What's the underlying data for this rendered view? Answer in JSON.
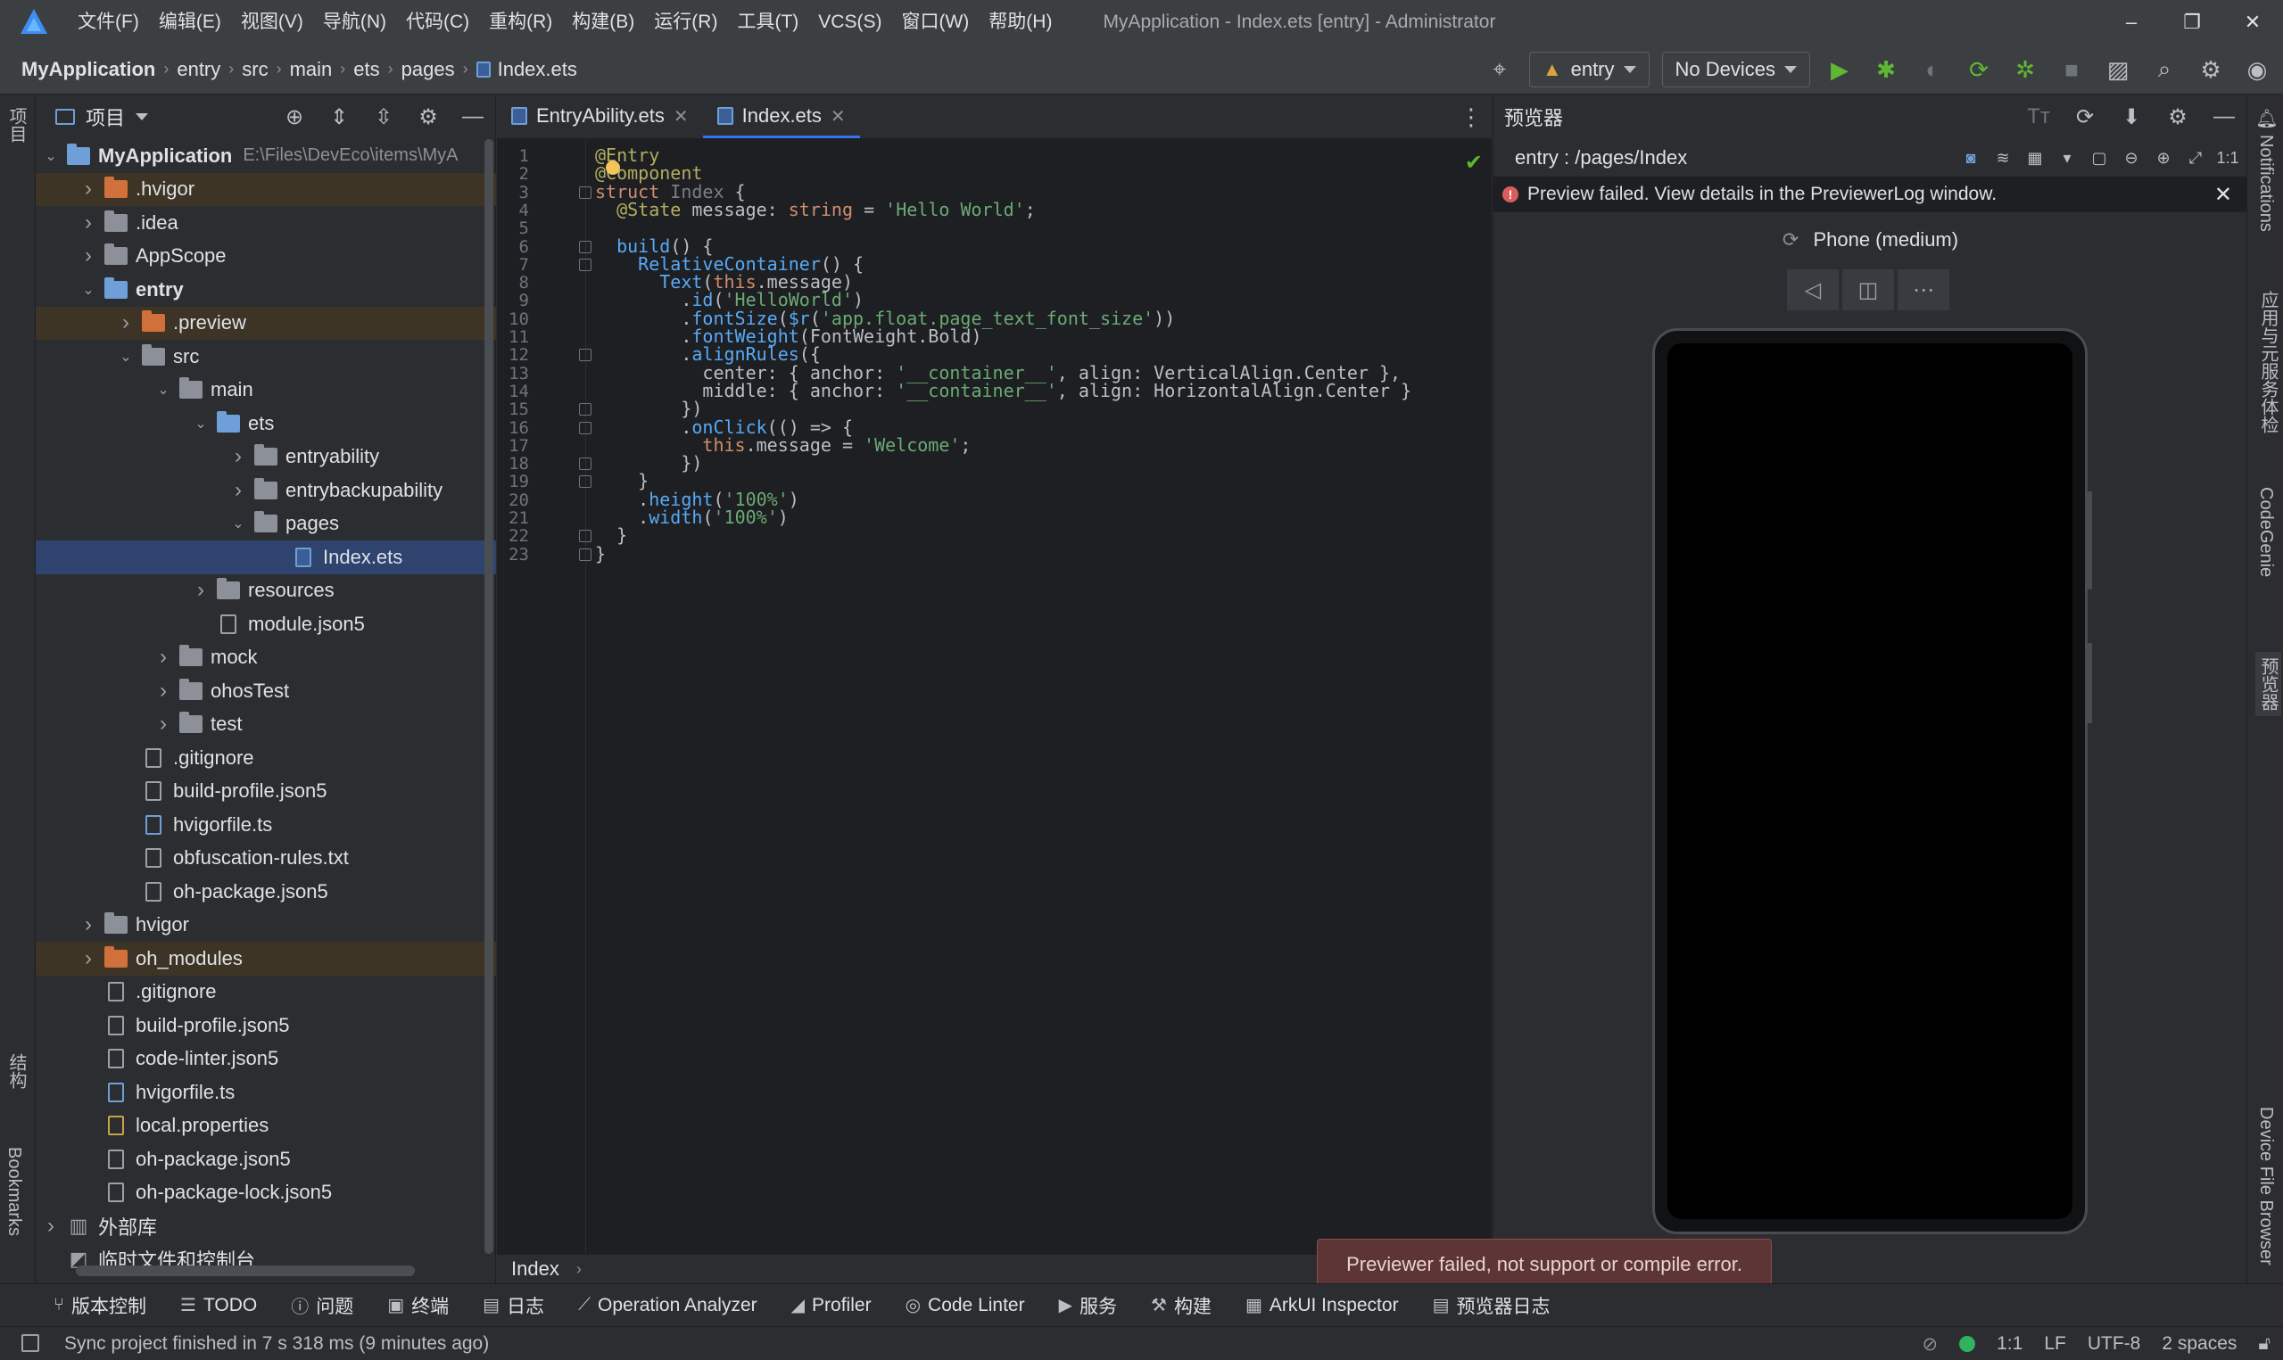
{
  "window": {
    "title": "MyApplication - Index.ets [entry] - Administrator",
    "menu": [
      "文件(F)",
      "编辑(E)",
      "视图(V)",
      "导航(N)",
      "代码(C)",
      "重构(R)",
      "构建(B)",
      "运行(R)",
      "工具(T)",
      "VCS(S)",
      "窗口(W)",
      "帮助(H)"
    ],
    "controls": [
      "–",
      "❐",
      "✕"
    ]
  },
  "breadcrumb": [
    "MyApplication",
    "entry",
    "src",
    "main",
    "ets",
    "pages",
    "Index.ets"
  ],
  "toolbar": {
    "module_combo": "entry",
    "device_combo": "No Devices"
  },
  "left_strip": {
    "top_tab": "项目",
    "structure_tab": "结构",
    "bookmarks_tab": "Bookmarks"
  },
  "project_panel": {
    "title": "项目",
    "tree": [
      {
        "depth": 0,
        "expanded": true,
        "has_chevron": true,
        "icon": "folder-blue",
        "label": "MyApplication",
        "hint": "E:\\Files\\DevEco\\items\\MyA",
        "bold": true
      },
      {
        "depth": 1,
        "expanded": false,
        "has_chevron": true,
        "icon": "folder-orange",
        "label": ".hvigor",
        "excluded": true
      },
      {
        "depth": 1,
        "expanded": false,
        "has_chevron": true,
        "icon": "folder",
        "label": ".idea"
      },
      {
        "depth": 1,
        "expanded": false,
        "has_chevron": true,
        "icon": "folder",
        "label": "AppScope"
      },
      {
        "depth": 1,
        "expanded": true,
        "has_chevron": true,
        "icon": "folder-blue",
        "label": "entry",
        "bold": true
      },
      {
        "depth": 2,
        "expanded": false,
        "has_chevron": true,
        "icon": "folder-orange",
        "label": ".preview",
        "excluded": true
      },
      {
        "depth": 2,
        "expanded": true,
        "has_chevron": true,
        "icon": "folder",
        "label": "src"
      },
      {
        "depth": 3,
        "expanded": true,
        "has_chevron": true,
        "icon": "folder",
        "label": "main"
      },
      {
        "depth": 4,
        "expanded": true,
        "has_chevron": true,
        "icon": "folder-blue",
        "label": "ets"
      },
      {
        "depth": 5,
        "expanded": false,
        "has_chevron": true,
        "icon": "folder",
        "label": "entryability"
      },
      {
        "depth": 5,
        "expanded": false,
        "has_chevron": true,
        "icon": "folder",
        "label": "entrybackupability"
      },
      {
        "depth": 5,
        "expanded": true,
        "has_chevron": true,
        "icon": "folder",
        "label": "pages"
      },
      {
        "depth": 6,
        "has_chevron": false,
        "icon": "file-ets",
        "label": "Index.ets",
        "selected": true
      },
      {
        "depth": 4,
        "expanded": false,
        "has_chevron": true,
        "icon": "folder",
        "label": "resources"
      },
      {
        "depth": 4,
        "has_chevron": false,
        "icon": "file",
        "label": "module.json5"
      },
      {
        "depth": 3,
        "expanded": false,
        "has_chevron": true,
        "icon": "folder",
        "label": "mock"
      },
      {
        "depth": 3,
        "expanded": false,
        "has_chevron": true,
        "icon": "folder",
        "label": "ohosTest"
      },
      {
        "depth": 3,
        "expanded": false,
        "has_chevron": true,
        "icon": "folder",
        "label": "test"
      },
      {
        "depth": 2,
        "has_chevron": false,
        "icon": "file",
        "label": ".gitignore"
      },
      {
        "depth": 2,
        "has_chevron": false,
        "icon": "file",
        "label": "build-profile.json5"
      },
      {
        "depth": 2,
        "has_chevron": false,
        "icon": "file-ts",
        "label": "hvigorfile.ts"
      },
      {
        "depth": 2,
        "has_chevron": false,
        "icon": "file",
        "label": "obfuscation-rules.txt"
      },
      {
        "depth": 2,
        "has_chevron": false,
        "icon": "file",
        "label": "oh-package.json5"
      },
      {
        "depth": 1,
        "expanded": false,
        "has_chevron": true,
        "icon": "folder",
        "label": "hvigor"
      },
      {
        "depth": 1,
        "expanded": false,
        "has_chevron": true,
        "icon": "folder-orange",
        "label": "oh_modules",
        "excluded": true
      },
      {
        "depth": 1,
        "has_chevron": false,
        "icon": "file",
        "label": ".gitignore"
      },
      {
        "depth": 1,
        "has_chevron": false,
        "icon": "file",
        "label": "build-profile.json5"
      },
      {
        "depth": 1,
        "has_chevron": false,
        "icon": "file",
        "label": "code-linter.json5"
      },
      {
        "depth": 1,
        "has_chevron": false,
        "icon": "file-ts",
        "label": "hvigorfile.ts"
      },
      {
        "depth": 1,
        "has_chevron": false,
        "icon": "file-prop",
        "label": "local.properties"
      },
      {
        "depth": 1,
        "has_chevron": false,
        "icon": "file",
        "label": "oh-package.json5"
      },
      {
        "depth": 1,
        "has_chevron": false,
        "icon": "file",
        "label": "oh-package-lock.json5"
      },
      {
        "depth": 0,
        "expanded": false,
        "has_chevron": true,
        "icon": "library",
        "label": "外部库"
      },
      {
        "depth": 0,
        "has_chevron": false,
        "icon": "scratch",
        "label": "临时文件和控制台"
      }
    ]
  },
  "editor": {
    "tabs": [
      {
        "label": "EntryAbility.ets",
        "active": false
      },
      {
        "label": "Index.ets",
        "active": true
      }
    ],
    "lines": [
      [
        [
          "an",
          "@Entry"
        ]
      ],
      [
        [
          "an",
          "@Component"
        ]
      ],
      [
        [
          "k",
          "struct "
        ],
        [
          "grey",
          "Index "
        ],
        [
          "",
          "{"
        ]
      ],
      [
        [
          "",
          "  "
        ],
        [
          "an",
          "@State "
        ],
        [
          "",
          "message: "
        ],
        [
          "k",
          "string "
        ],
        [
          "",
          "= "
        ],
        [
          "s",
          "'Hello World'"
        ],
        [
          "",
          ";"
        ]
      ],
      [],
      [
        [
          "",
          "  "
        ],
        [
          "fn",
          "build"
        ],
        [
          "",
          "() {"
        ]
      ],
      [
        [
          "",
          "    "
        ],
        [
          "fn",
          "RelativeContainer"
        ],
        [
          "",
          "() {"
        ]
      ],
      [
        [
          "",
          "      "
        ],
        [
          "fn",
          "Text"
        ],
        [
          "",
          "("
        ],
        [
          "k",
          "this"
        ],
        [
          "",
          ".message)"
        ]
      ],
      [
        [
          "",
          "        ."
        ],
        [
          "fn",
          "id"
        ],
        [
          "",
          "("
        ],
        [
          "s",
          "'HelloWorld'"
        ],
        [
          "",
          ")"
        ]
      ],
      [
        [
          "",
          "        ."
        ],
        [
          "fn",
          "fontSize"
        ],
        [
          "",
          "("
        ],
        [
          "fn",
          "$r"
        ],
        [
          "",
          "("
        ],
        [
          "s",
          "'app.float.page_text_font_size'"
        ],
        [
          "",
          "))"
        ]
      ],
      [
        [
          "",
          "        ."
        ],
        [
          "fn",
          "fontWeight"
        ],
        [
          "",
          "(FontWeight.Bold)"
        ]
      ],
      [
        [
          "",
          "        ."
        ],
        [
          "fn",
          "alignRules"
        ],
        [
          "",
          "({"
        ]
      ],
      [
        [
          "",
          "          center: { anchor: "
        ],
        [
          "s",
          "'__container__'"
        ],
        [
          "",
          ", align: VerticalAlign.Center },"
        ]
      ],
      [
        [
          "",
          "          middle: { anchor: "
        ],
        [
          "s",
          "'__container__'"
        ],
        [
          "",
          ", align: HorizontalAlign.Center }"
        ]
      ],
      [
        [
          "",
          "        })"
        ]
      ],
      [
        [
          "",
          "        ."
        ],
        [
          "fn",
          "onClick"
        ],
        [
          "",
          "(() => {"
        ]
      ],
      [
        [
          "",
          "          "
        ],
        [
          "k",
          "this"
        ],
        [
          "",
          ".message = "
        ],
        [
          "s",
          "'Welcome'"
        ],
        [
          "",
          ";"
        ]
      ],
      [
        [
          "",
          "        })"
        ]
      ],
      [
        [
          "",
          "    }"
        ]
      ],
      [
        [
          "",
          "    ."
        ],
        [
          "fn",
          "height"
        ],
        [
          "",
          "("
        ],
        [
          "s",
          "'100%'"
        ],
        [
          "",
          ")"
        ]
      ],
      [
        [
          "",
          "    ."
        ],
        [
          "fn",
          "width"
        ],
        [
          "",
          "("
        ],
        [
          "s",
          "'100%'"
        ],
        [
          "",
          ")"
        ]
      ],
      [
        [
          "",
          "  }"
        ]
      ],
      [
        [
          "",
          "}"
        ]
      ]
    ],
    "crumb": "Index"
  },
  "previewer": {
    "title": "预览器",
    "route": "entry : /pages/Index",
    "error": "Preview failed. View details in the PreviewerLog window.",
    "device": "Phone (medium)"
  },
  "right_strip": [
    "Notifications",
    "应用与元服务体检",
    "CodeGenie",
    "预览器",
    "Device File Browser"
  ],
  "bottom_bar": [
    {
      "icon": "vcs-icon",
      "glyph": "⑂",
      "label": "版本控制"
    },
    {
      "icon": "todo-icon",
      "glyph": "☰",
      "label": "TODO"
    },
    {
      "icon": "problems-icon",
      "glyph": "ⓘ",
      "label": "问题"
    },
    {
      "icon": "terminal-icon",
      "glyph": "▣",
      "label": "终端"
    },
    {
      "icon": "log-icon",
      "glyph": "▤",
      "label": "日志"
    },
    {
      "icon": "analyzer-icon",
      "glyph": "⟋",
      "label": "Operation Analyzer"
    },
    {
      "icon": "profiler-icon",
      "glyph": "◢",
      "label": "Profiler"
    },
    {
      "icon": "linter-icon",
      "glyph": "◎",
      "label": "Code Linter"
    },
    {
      "icon": "services-icon",
      "glyph": "▶",
      "label": "服务"
    },
    {
      "icon": "build-icon",
      "glyph": "⚒",
      "label": "构建"
    },
    {
      "icon": "inspector-icon",
      "glyph": "▦",
      "label": "ArkUI Inspector"
    },
    {
      "icon": "previewer-log-icon",
      "glyph": "▤",
      "label": "预览器日志"
    }
  ],
  "status": {
    "message": "Sync project finished in 7 s 318 ms (9 minutes ago)",
    "position": "1:1",
    "line_sep": "LF",
    "encoding": "UTF-8",
    "indent": "2 spaces"
  },
  "toast": "Previewer failed, not support or compile error."
}
